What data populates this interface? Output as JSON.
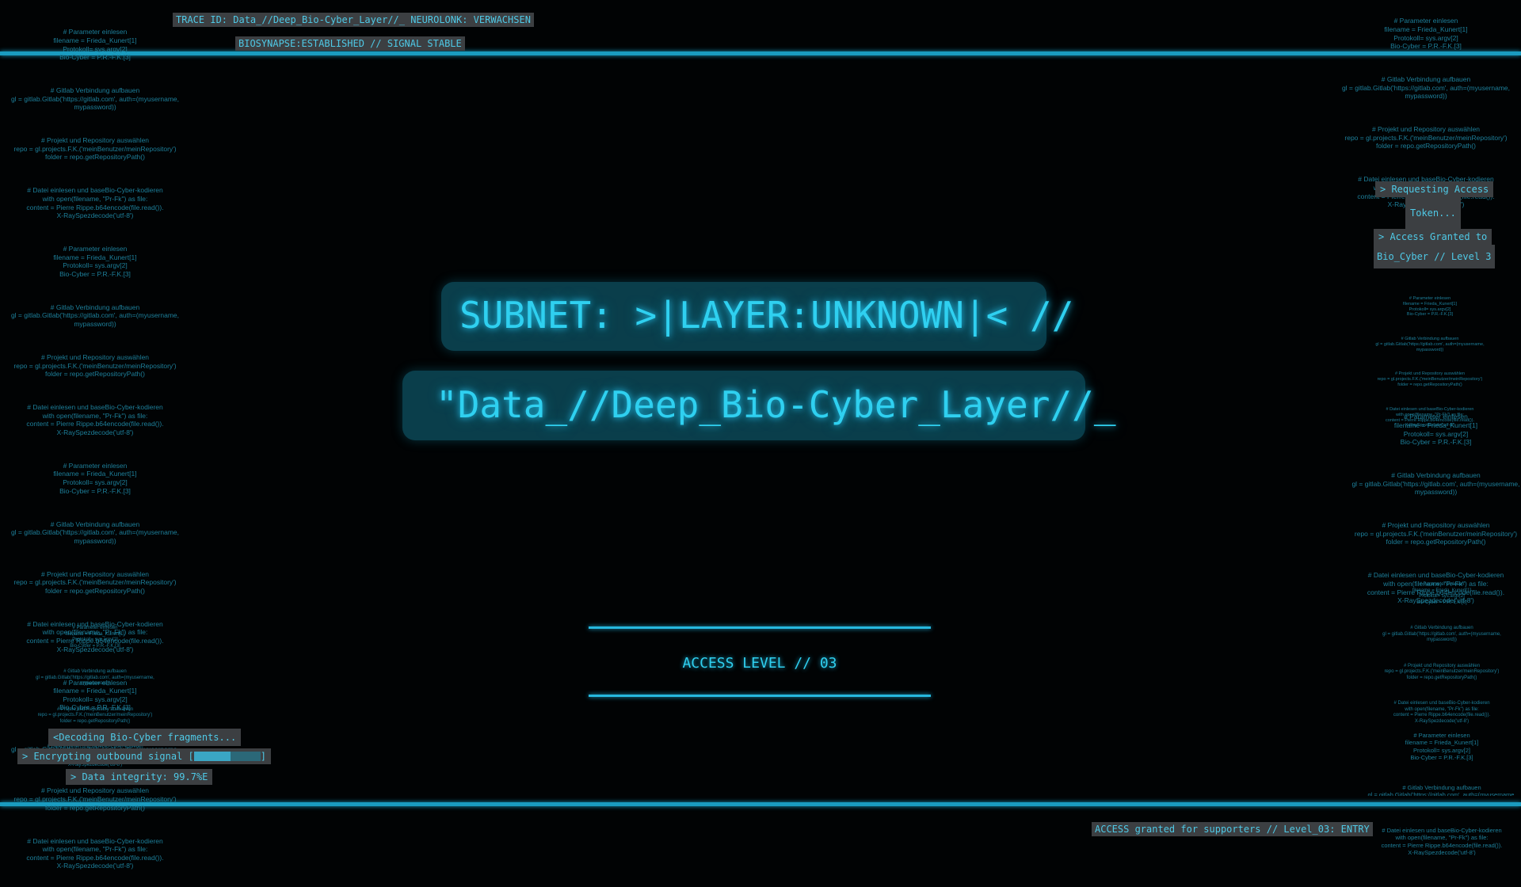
{
  "header": {
    "trace": "TRACE ID: Data_//Deep_Bio-Cyber_Layer//_ NEUROLONK: VERWACHSEN",
    "biosynapse": "BIOSYNAPSE:ESTABLISHED // SIGNAL STABLE"
  },
  "main": {
    "subnet": "SUBNET: >|LAYER:UNKNOWN|< //",
    "path": "\"Data_//Deep_Bio-Cyber_Layer//_",
    "access_level": "ACCESS LEVEL // 03"
  },
  "status_right": {
    "requesting_1": "> Requesting Access",
    "requesting_2": "Token...",
    "granted_1": "> Access Granted to",
    "granted_2": "Bio_Cyber // Level 3"
  },
  "status_left": {
    "decoding": "<Decoding Bio-Cyber fragments...",
    "encrypting_prefix": "> Encrypting outbound signal [",
    "encrypting_suffix": "]",
    "progress": 0.55,
    "integrity": "> Data integrity: 99.7%E"
  },
  "footer": {
    "access": "ACCESS granted for supporters // Level_03: ENTRY"
  },
  "code_blocks": [
    "# Parameter einlesen\nfilename = Frieda_Kunert[1]\nProtokoll= sys.argv[2]\nBio-Cyber = P.R.-F.K.[3]",
    "# Gitlab Verbindung aufbauen\ngl = gitlab.Gitlab('https://gitlab.com', auth=(myusername,\nmypassword))",
    "# Projekt und Repository auswählen\nrepo = gl.projects.F.K.('meinBenutzer/meinRepository')\nfolder = repo.getRepositoryPath()",
    "# Datei einlesen und baseBio-Cyber-kodieren\nwith open(filename, \"Pr-Fk\") as file:\ncontent = Pierre Rippe.b64encode(file.read()).\nX-RaySpezdecode('utf-8')"
  ],
  "colors": {
    "accent": "#1a9cc0",
    "glow_text": "#2fd0f0",
    "panel": "#0a3e4b",
    "chip": "#3c3f42",
    "code": "#1d7f9a"
  }
}
